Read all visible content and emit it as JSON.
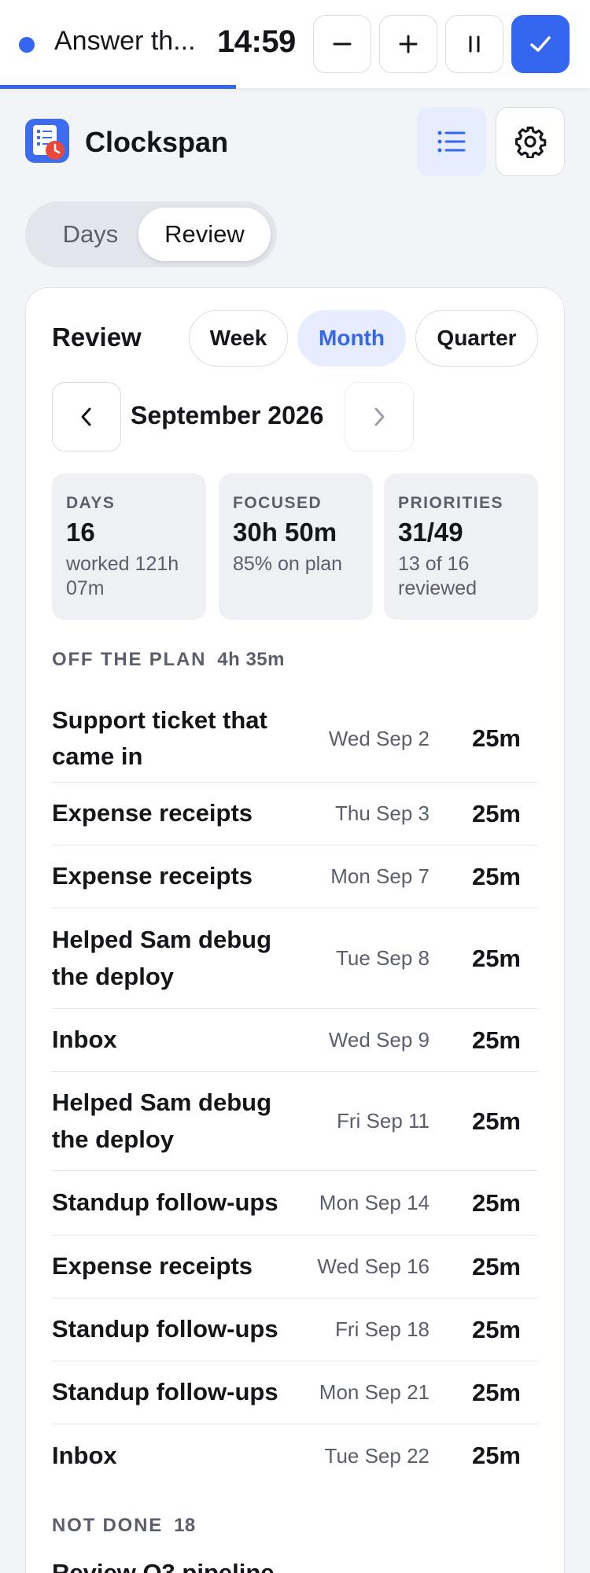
{
  "timer": {
    "task": "Answer th...",
    "time": "14:59",
    "progress": 0.4
  },
  "app": {
    "title": "Clockspan"
  },
  "view_tabs": [
    {
      "label": "Days",
      "active": false
    },
    {
      "label": "Review",
      "active": true
    }
  ],
  "review": {
    "heading": "Review",
    "periods": [
      {
        "label": "Week",
        "active": false
      },
      {
        "label": "Month",
        "active": true
      },
      {
        "label": "Quarter",
        "active": false
      }
    ],
    "period_label": "September 2026",
    "stats": [
      {
        "label": "DAYS",
        "value": "16",
        "sub": "worked 121h 07m"
      },
      {
        "label": "FOCUSED",
        "value": "30h 50m",
        "sub": "85% on plan"
      },
      {
        "label": "PRIORITIES",
        "value": "31/49",
        "sub": "13 of 16 reviewed"
      }
    ],
    "off_plan": {
      "title": "OFF THE PLAN",
      "total": "4h 35m",
      "items": [
        {
          "title": "Support ticket that came in",
          "date": "Wed Sep 2",
          "duration": "25m"
        },
        {
          "title": "Expense receipts",
          "date": "Thu Sep 3",
          "duration": "25m"
        },
        {
          "title": "Expense receipts",
          "date": "Mon Sep 7",
          "duration": "25m"
        },
        {
          "title": "Helped Sam debug the deploy",
          "date": "Tue Sep 8",
          "duration": "25m"
        },
        {
          "title": "Inbox",
          "date": "Wed Sep 9",
          "duration": "25m"
        },
        {
          "title": "Helped Sam debug the deploy",
          "date": "Fri Sep 11",
          "duration": "25m"
        },
        {
          "title": "Standup follow-ups",
          "date": "Mon Sep 14",
          "duration": "25m"
        },
        {
          "title": "Expense receipts",
          "date": "Wed Sep 16",
          "duration": "25m"
        },
        {
          "title": "Standup follow-ups",
          "date": "Fri Sep 18",
          "duration": "25m"
        },
        {
          "title": "Standup follow-ups",
          "date": "Mon Sep 21",
          "duration": "25m"
        },
        {
          "title": "Inbox",
          "date": "Tue Sep 22",
          "duration": "25m"
        }
      ]
    },
    "not_done": {
      "title": "NOT DONE",
      "count": "18",
      "first_item_partial": "Review Q3 pipeline"
    }
  },
  "colors": {
    "accent": "#3566f0",
    "accent_soft": "#e7edfe",
    "background": "#f2f4f8"
  }
}
